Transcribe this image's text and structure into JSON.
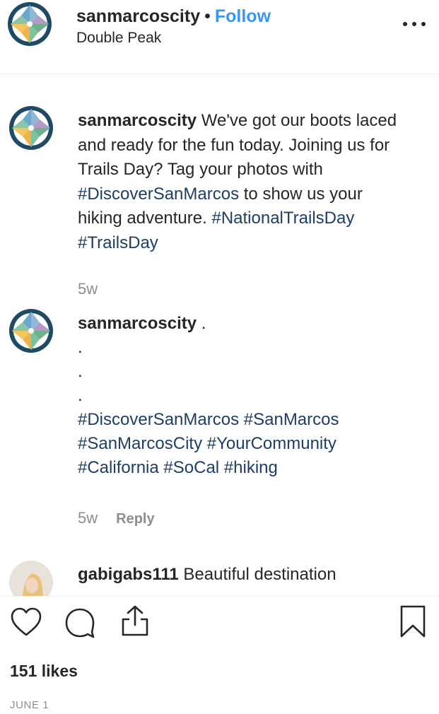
{
  "post": {
    "owner": "sanmarcoscity",
    "separator": "•",
    "follow_label": "Follow",
    "location": "Double Peak"
  },
  "comments": [
    {
      "username": "sanmarcoscity",
      "text_before": " We've got our boots laced and ready for the fun today. Joining us for Trails Day? Tag your photos with ",
      "tag1": "#DiscoverSanMarcos",
      "text_middle": " to show us your hiking adventure. ",
      "tag2": "#NationalTrailsDay",
      "tag3": "#TrailsDay",
      "time": "5w"
    },
    {
      "username": "sanmarcoscity",
      "first_line": " .",
      "dot_lines": [
        ".",
        ".",
        "."
      ],
      "tags": [
        "#DiscoverSanMarcos",
        "#SanMarcos",
        "#SanMarcosCity",
        "#YourCommunity",
        "#California",
        "#SoCal",
        "#hiking"
      ],
      "time": "5w",
      "reply_label": "Reply"
    },
    {
      "username": "gabigabs111",
      "text": " Beautiful destination"
    }
  ],
  "actions": {
    "likes": "151 likes",
    "date": "JUNE 1"
  },
  "icons": {
    "avatar": "compass-star-logo",
    "like": "heart-icon",
    "comment": "comment-bubble-icon",
    "share": "share-icon",
    "save": "bookmark-icon",
    "more": "more-options-icon"
  },
  "colors": {
    "follow": "#3897f0",
    "hashtag": "#1e3e68",
    "muted": "#8e8e8e",
    "text": "#262626"
  }
}
